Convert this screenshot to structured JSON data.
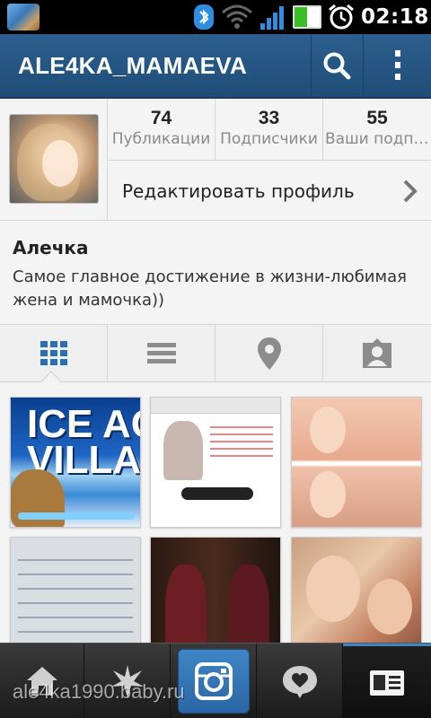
{
  "status_bar": {
    "time": "02:18",
    "icons": [
      "app-icon",
      "bluetooth-icon",
      "wifi-icon",
      "signal-icon",
      "battery-icon",
      "alarm-icon"
    ]
  },
  "header": {
    "username": "ALE4KA_MAMAEVA",
    "icons": [
      "search-icon",
      "more-vert-icon"
    ],
    "accent_color": "#2a5d8c"
  },
  "profile": {
    "stats": [
      {
        "value": "74",
        "label": "Публикации"
      },
      {
        "value": "33",
        "label": "Подписчики"
      },
      {
        "value": "55",
        "label": "Ваши подписки"
      }
    ],
    "edit_button": "Редактировать профиль",
    "name": "Алечка",
    "bio": "Самое главное достижение в жизни-любимая жена и мамочка))"
  },
  "view_tabs": {
    "active": "grid",
    "items": [
      "grid-view-icon",
      "list-view-icon",
      "map-pin-icon",
      "tagged-person-icon"
    ]
  },
  "photos": [
    {
      "icons": "ice-age-game-thumbnail",
      "text": "ICE AGE VILLAGE"
    },
    {
      "icons": "website-ad-thumbnail",
      "text": ""
    },
    {
      "icons": "selfie-collage-thumbnail",
      "text": ""
    },
    {
      "icons": "chat-screenshot-thumbnail",
      "text": ""
    },
    {
      "icons": "mirror-selfie-thumbnail",
      "text": ""
    },
    {
      "icons": "mother-child-thumbnail",
      "text": ""
    }
  ],
  "bottom_nav": {
    "active": "profile",
    "items": [
      "home-icon",
      "explore-star-icon",
      "camera-icon",
      "activity-heart-icon",
      "profile-card-icon"
    ]
  },
  "watermark": "ale4ka1990.baby.ru"
}
